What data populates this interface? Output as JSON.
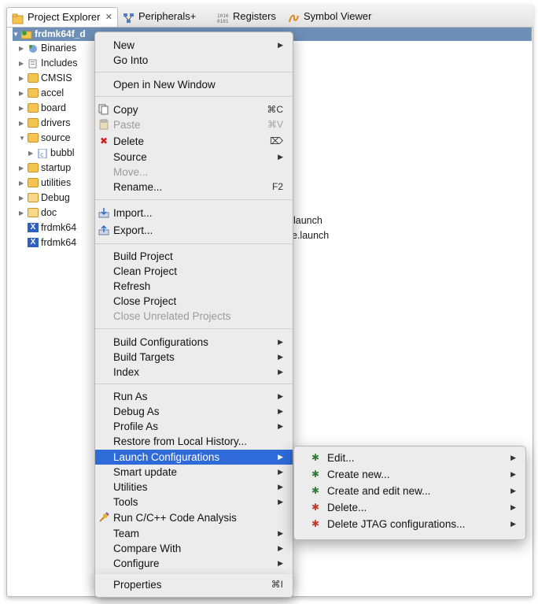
{
  "tabs": {
    "project_explorer": "Project Explorer",
    "project_explorer_close": "✕",
    "peripherals": "Peripherals+",
    "registers": "Registers",
    "symbol_viewer": "Symbol Viewer"
  },
  "tree": {
    "root": "frdmk64f_d",
    "items": [
      "Binaries",
      "Includes",
      "CMSIS",
      "accel",
      "board",
      "drivers",
      "source",
      "bubbl",
      "startup",
      "utilities",
      "Debug",
      "doc",
      "frdmk64",
      "frdmk64"
    ],
    "launch_tail_1": "launch",
    "launch_tail_2": "e.launch"
  },
  "context_menu": {
    "new": "New",
    "go_into": "Go Into",
    "open_new_window": "Open in New Window",
    "copy": "Copy",
    "copy_shortcut": "⌘C",
    "paste": "Paste",
    "paste_shortcut": "⌘V",
    "delete": "Delete",
    "delete_shortcut": "⌦",
    "source": "Source",
    "move": "Move...",
    "rename": "Rename...",
    "rename_shortcut": "F2",
    "import": "Import...",
    "export": "Export...",
    "build_project": "Build Project",
    "clean_project": "Clean Project",
    "refresh": "Refresh",
    "close_project": "Close Project",
    "close_unrelated": "Close Unrelated Projects",
    "build_configurations": "Build Configurations",
    "build_targets": "Build Targets",
    "index": "Index",
    "run_as": "Run As",
    "debug_as": "Debug As",
    "profile_as": "Profile As",
    "restore_history": "Restore from Local History...",
    "launch_configurations": "Launch Configurations",
    "smart_update": "Smart update",
    "utilities": "Utilities",
    "tools": "Tools",
    "run_code_analysis": "Run C/C++ Code Analysis",
    "team": "Team",
    "compare_with": "Compare With",
    "configure": "Configure",
    "properties": "Properties",
    "properties_shortcut": "⌘I"
  },
  "submenu": {
    "edit": "Edit...",
    "create_new": "Create new...",
    "create_and_edit": "Create and edit new...",
    "delete": "Delete...",
    "delete_jtag": "Delete JTAG configurations..."
  },
  "colors": {
    "selection": "#2e6bd9",
    "root_row": "#6d8fb8",
    "menu_bg": "#ececec"
  }
}
